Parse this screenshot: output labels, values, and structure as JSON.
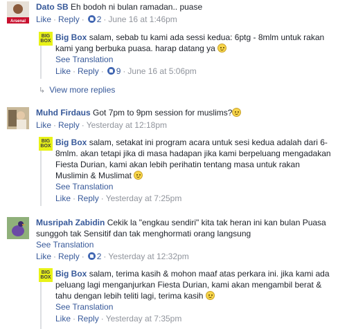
{
  "comments": [
    {
      "name": "Dato SB",
      "text": "Eh bodoh ni bulan ramadan.. puase",
      "like": "Like",
      "reply": "Reply",
      "likes": "2",
      "time": "June 16 at 1:46pm",
      "replies": [
        {
          "name": "Big Box",
          "text": "salam, sebab tu kami ada sessi kedua: 6ptg - 8mlm untuk rakan kami yang berbuka puasa. harap datang ya",
          "see_translation": "See Translation",
          "like": "Like",
          "reply": "Reply",
          "likes": "9",
          "time": "June 16 at 5:06pm"
        }
      ],
      "view_more": "View more replies"
    },
    {
      "name": "Muhd Firdaus",
      "text": "Got 7pm to 9pm session for muslims?",
      "like": "Like",
      "reply": "Reply",
      "time": "Yesterday at 12:18pm",
      "replies": [
        {
          "name": "Big Box",
          "text": "salam, setakat ini program acara untuk sesi kedua adalah dari 6-8mlm. akan tetapi jika di masa hadapan jika kami berpeluang mengadakan Fiesta Durian, kami akan lebih perihatin tentang masa untuk rakan Muslimin & Muslimat",
          "see_translation": "See Translation",
          "like": "Like",
          "reply": "Reply",
          "time": "Yesterday at 7:25pm"
        }
      ]
    },
    {
      "name": "Musripah Zabidin",
      "text": "Cekik la \"engkau sendiri\" kita tak heran ini kan bulan Puasa sunggoh tak Sensitif dan tak menghormati orang langsung",
      "see_translation": "See Translation",
      "like": "Like",
      "reply": "Reply",
      "likes": "2",
      "time": "Yesterday at 12:32pm",
      "replies": [
        {
          "name": "Big Box",
          "text": "salam, terima kasih & mohon maaf atas perkara ini. jika kami ada peluang lagi menganjurkan Fiesta Durian, kami akan mengambil berat & tahu dengan lebih teliti lagi, terima kasih",
          "see_translation": "See Translation",
          "like": "Like",
          "reply": "Reply",
          "time": "Yesterday at 7:35pm"
        }
      ]
    }
  ],
  "avatar_dato_caption": "Arsenal",
  "bigbox_logo": [
    "BIG",
    "BOX"
  ]
}
